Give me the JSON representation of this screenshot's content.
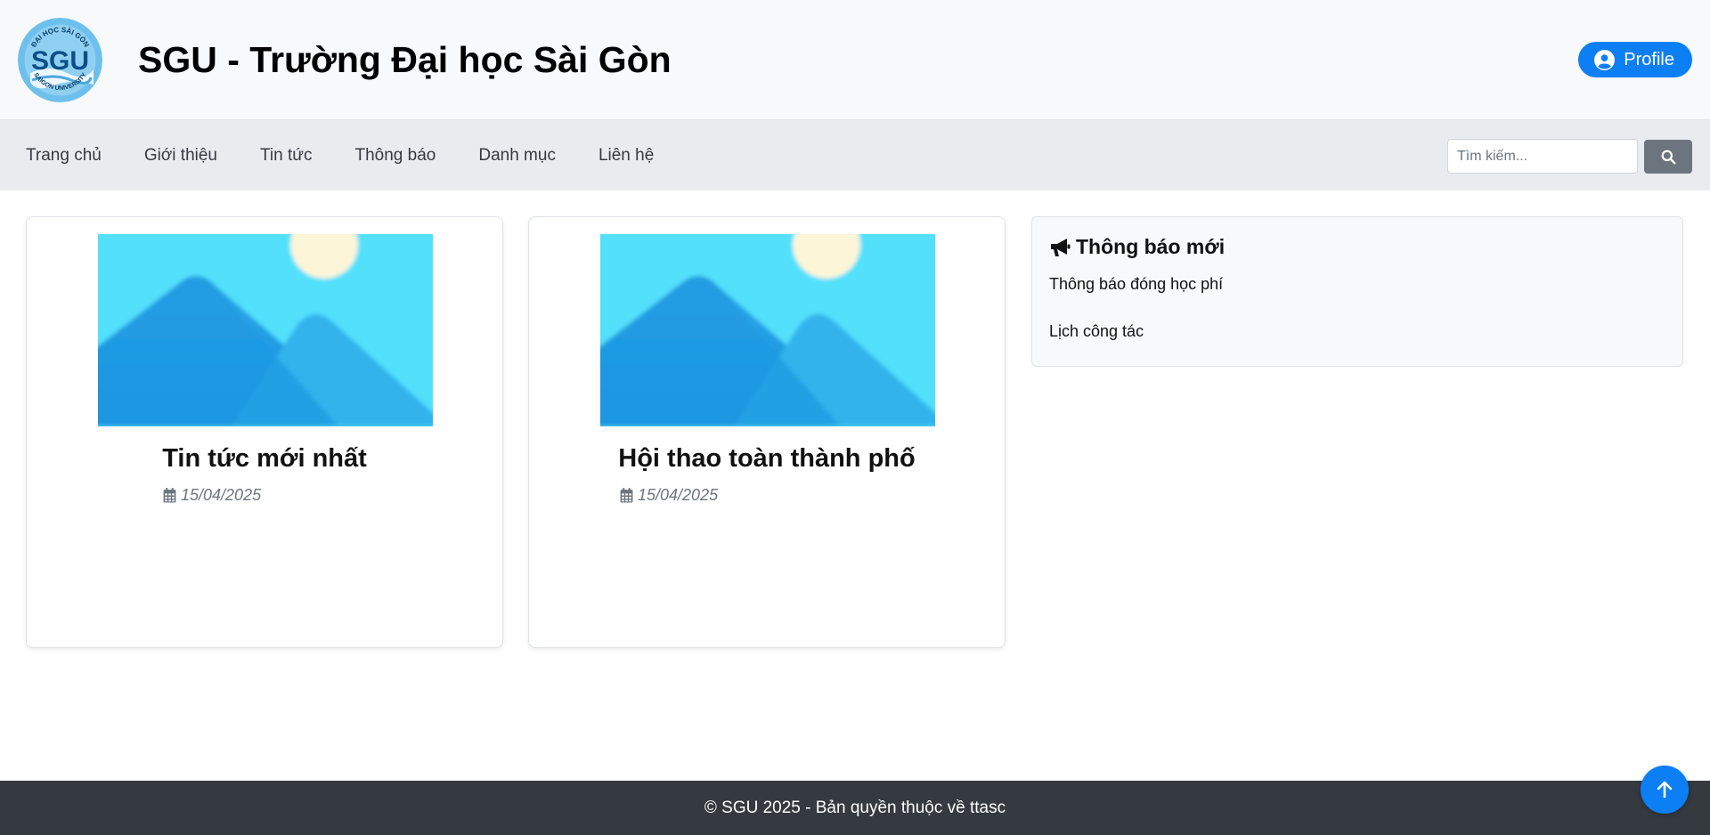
{
  "header": {
    "logo_text": "SGU",
    "logo_ring_top": "ĐẠI HỌC SÀI GÒN",
    "logo_ring_bottom": "SAIGON UNIVERSITY",
    "title": "SGU - Trường Đại học Sài Gòn",
    "profile_label": "Profile",
    "profile_icon": "user-circle-icon"
  },
  "nav": {
    "items": [
      "Trang chủ",
      "Giới thiệu",
      "Tin tức",
      "Thông báo",
      "Danh mục",
      "Liên hệ"
    ]
  },
  "search": {
    "placeholder": "Tìm kiếm...",
    "value": "",
    "icon": "search-icon"
  },
  "news": [
    {
      "title": "Tin tức mới nhất",
      "date": "15/04/2025",
      "image": "image-placeholder",
      "date_icon": "calendar-icon"
    },
    {
      "title": "Hội thao toàn thành phố",
      "date": "15/04/2025",
      "image": "image-placeholder",
      "date_icon": "calendar-icon"
    }
  ],
  "notices": {
    "heading": "Thông báo mới",
    "icon": "megaphone-icon",
    "items": [
      "Thông báo đóng học phí",
      "Lịch công tác"
    ]
  },
  "footer": {
    "text": "© SGU 2025 - Bản quyền thuộc về ttasc"
  },
  "back_to_top": {
    "icon": "arrow-up-icon"
  },
  "colors": {
    "primary": "#0d7ff5",
    "header_bg": "#f8f9fa",
    "nav_bg": "#e9ecef",
    "footer_bg": "#343a40",
    "search_btn": "#6c757d",
    "logo_blue": "#4fb0e6"
  }
}
